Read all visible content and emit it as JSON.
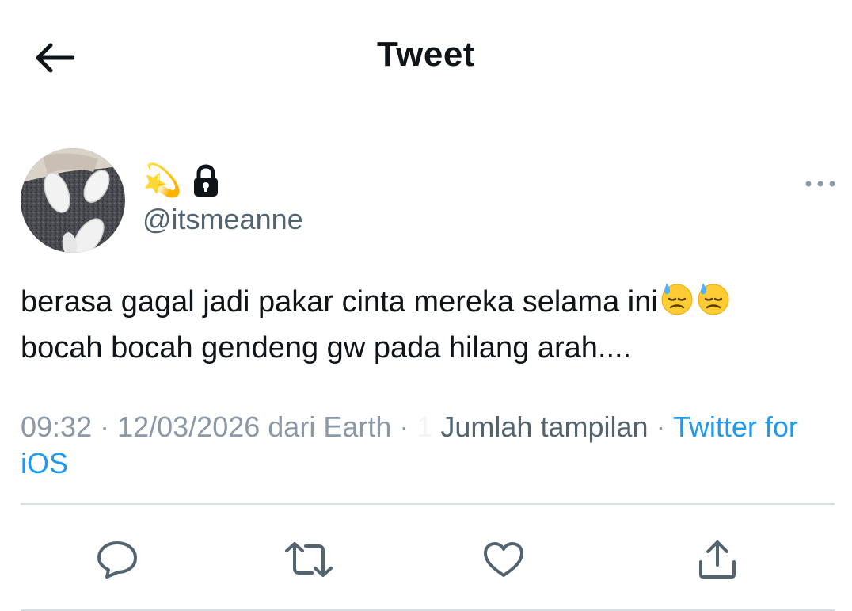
{
  "header": {
    "title": "Tweet",
    "back_icon": "arrow-left-icon"
  },
  "tweet": {
    "author": {
      "display_name_emoji": "💫",
      "protected_icon": "lock-icon",
      "handle": "@itsmeanne",
      "avatar": "avatar-photo-shoes"
    },
    "more_icon": "more-horizontal-icon",
    "text_line1": "berasa gagal jadi pakar cinta mereka selama ini",
    "text_line2": "bocah bocah gendeng gw pada hilang arah....",
    "text_emojis": [
      "downcast-face-with-sweat",
      "downcast-face-with-sweat"
    ],
    "meta": {
      "time": "09:32",
      "sep1": " · ",
      "date": "12/03/2026",
      "location": " dari Earth",
      "sep2": " · ",
      "views_count": "1",
      "views_label": " Jumlah tampilan",
      "sep3": " · ",
      "source": "Twitter for iOS"
    }
  },
  "actions": [
    {
      "name": "reply",
      "icon": "reply-icon"
    },
    {
      "name": "retweet",
      "icon": "retweet-icon"
    },
    {
      "name": "like",
      "icon": "heart-icon"
    },
    {
      "name": "share",
      "icon": "share-icon"
    }
  ],
  "colors": {
    "text_primary": "#0f1419",
    "text_secondary": "#536471",
    "text_muted": "#8b98a5",
    "link": "#1d9bf0",
    "divider": "#d6dde3"
  }
}
